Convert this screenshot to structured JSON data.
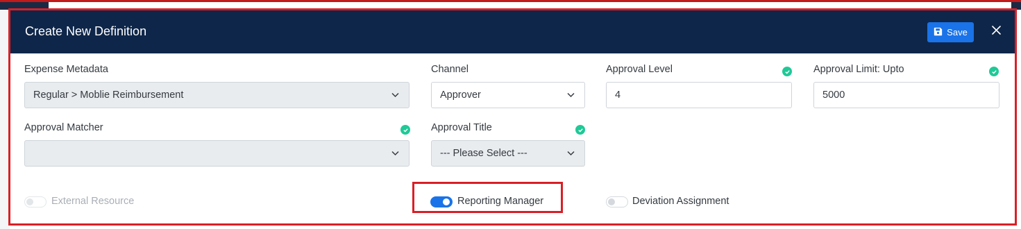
{
  "modal": {
    "title": "Create New Definition",
    "save_label": "Save",
    "close_icon": "close-icon",
    "save_icon": "floppy-disk-icon"
  },
  "fields": {
    "expense_metadata": {
      "label": "Expense Metadata",
      "value": "Regular > Moblie Reimbursement"
    },
    "channel": {
      "label": "Channel",
      "value": "Approver"
    },
    "approval_level": {
      "label": "Approval Level",
      "value": "4",
      "validated": true
    },
    "approval_limit": {
      "label": "Approval Limit: Upto",
      "value": "5000",
      "validated": true
    },
    "approval_matcher": {
      "label": "Approval Matcher",
      "value": "",
      "validated": true
    },
    "approval_title": {
      "label": "Approval Title",
      "value": "--- Please Select ---",
      "validated": true
    }
  },
  "toggles": {
    "external_resource": {
      "label": "External Resource",
      "on": false,
      "disabled": true
    },
    "reporting_manager": {
      "label": "Reporting Manager",
      "on": true,
      "disabled": false
    },
    "deviation_assignment": {
      "label": "Deviation Assignment",
      "on": false,
      "disabled": false
    }
  },
  "colors": {
    "header_bg": "#0e2649",
    "accent": "#1a73e8",
    "valid_check": "#20c997",
    "highlight_border": "#d91f26"
  }
}
